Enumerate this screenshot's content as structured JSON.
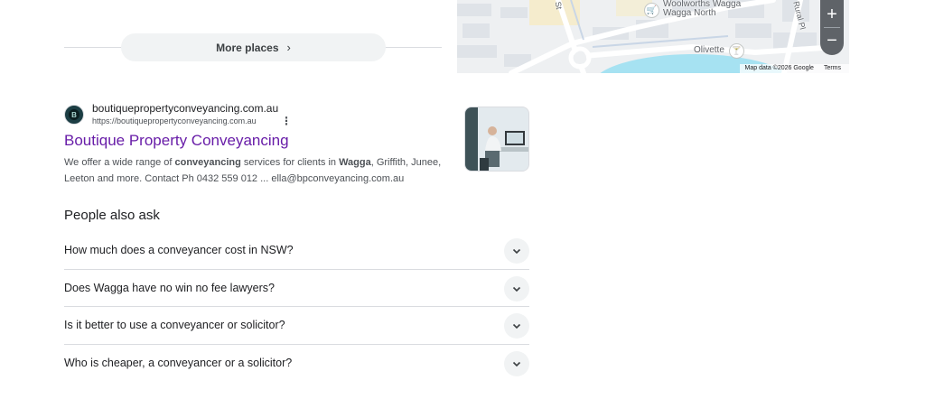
{
  "more_places": {
    "label": "More places",
    "chevron": "›"
  },
  "map": {
    "colors": {
      "water": "#a6e2f2",
      "road": "#ffffff",
      "block": "#dfe3e8",
      "land": "#eef0f2",
      "highlight": "#f5eccd"
    },
    "labels": {
      "woolworths_line1": "Woolworths Wagga",
      "woolworths_line2": "Wagga North",
      "olivette": "Olivette",
      "street_st": "St",
      "street_rural": "Rural Pl"
    },
    "zoom_in": "+",
    "zoom_out": "−",
    "attribution": "Map data ©2026 Google",
    "terms": "Terms",
    "pin_icons": [
      "shopping-cart-icon",
      "cocktail-glass-icon"
    ]
  },
  "result": {
    "site_name": "boutiquepropertyconveyancing.com.au",
    "url": "https://boutiquepropertyconveyancing.com.au",
    "favicon_letter": "B",
    "menu_icon": "⋮",
    "title": "Boutique Property Conveyancing",
    "snippet": {
      "p1": "We offer a wide range of ",
      "b1": "conveyancing",
      "p2": " services for clients in ",
      "b2": "Wagga",
      "p3": ", Griffith, Junee, Leeton and more. Contact Ph 0432 559 012 ... ella@bpconveyancing.com.au"
    },
    "title_color": "#681da8"
  },
  "people_also_ask": {
    "heading": "People also ask",
    "questions": [
      "How much does a conveyancer cost in NSW?",
      "Does Wagga have no win no fee lawyers?",
      "Is it better to use a conveyancer or solicitor?",
      "Who is cheaper, a conveyancer or a solicitor?"
    ],
    "expand_icon": "chevron-down-icon"
  }
}
